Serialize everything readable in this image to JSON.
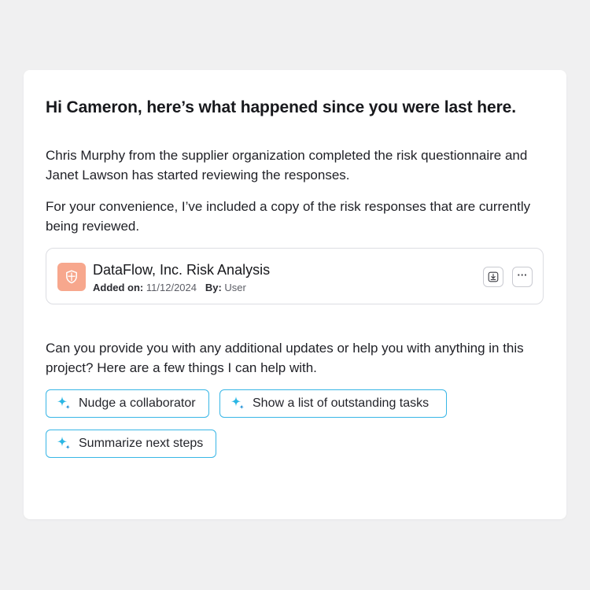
{
  "message": {
    "greeting": "Hi Cameron, here’s what happened since you were last here.",
    "paragraph1": "Chris Murphy from the supplier organization completed the risk questionnaire and Janet Lawson has started reviewing the responses.",
    "paragraph2": "For your convenience, I’ve included a copy of the risk responses that are currently being reviewed.",
    "paragraph3": "Can you provide you with any additional updates or help you with anything in this project? Here are a few things I can help with."
  },
  "attachment": {
    "icon": "shield-icon",
    "title": "DataFlow, Inc. Risk Analysis",
    "added_label": "Added on:",
    "added_value": "11/12/2024",
    "by_label": "By:",
    "by_value": "User",
    "download_icon": "download-icon",
    "more_label": "···"
  },
  "suggestions": [
    {
      "label": "Nudge a collaborator",
      "icon": "sparkle-icon"
    },
    {
      "label": "Show a list of outstanding tasks",
      "icon": "sparkle-icon"
    },
    {
      "label": "Summarize next steps",
      "icon": "sparkle-icon"
    }
  ],
  "colors": {
    "page_bg": "#f0f0f1",
    "card_bg": "#ffffff",
    "file_icon_bg": "#f7a78d",
    "chip_border": "#38b6e6",
    "sparkle": "#2bb7e4"
  }
}
